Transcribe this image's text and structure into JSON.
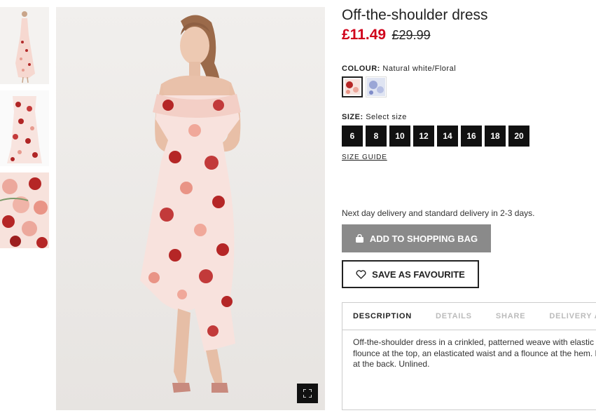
{
  "product": {
    "title": "Off-the-shoulder dress",
    "price_now": "£11.49",
    "price_old": "£29.99"
  },
  "colour": {
    "label": "COLOUR:",
    "value": "Natural white/Floral",
    "swatches": [
      {
        "name": "Natural white/Floral",
        "selected": true
      },
      {
        "name": "Light blue/Floral",
        "selected": false
      }
    ]
  },
  "size": {
    "label": "SIZE:",
    "placeholder": "Select size",
    "options": [
      "6",
      "8",
      "10",
      "12",
      "14",
      "16",
      "18",
      "20"
    ],
    "guide_label": "SIZE GUIDE"
  },
  "delivery_text": "Next day delivery and standard delivery in 2-3 days.",
  "buttons": {
    "add_to_bag": "ADD TO SHOPPING BAG",
    "save_favourite": "SAVE AS FAVOURITE"
  },
  "tabs": [
    {
      "label": "DESCRIPTION",
      "active": true
    },
    {
      "label": "DETAILS",
      "active": false
    },
    {
      "label": "SHARE",
      "active": false
    },
    {
      "label": "DELIVERY A",
      "active": false
    }
  ],
  "description": "Off-the-shoulder dress in a crinkled, patterned weave with elastic flounce at the top, an elasticated waist and a flounce at the hem. Lined at the back. Unlined.",
  "icons": {
    "zoom": "fullscreen-icon",
    "bag": "shopping-bag-icon",
    "favourite": "heart-icon"
  },
  "colors": {
    "price_red": "#d0021b",
    "add_to_bag_bg": "#8a8a8a",
    "size_bg": "#111111"
  }
}
